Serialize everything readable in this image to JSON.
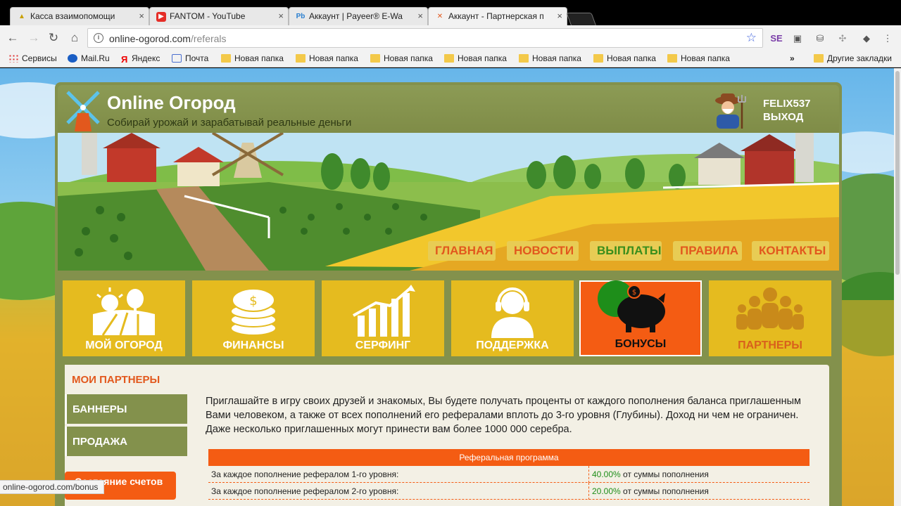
{
  "browser": {
    "tabs": [
      {
        "title": "Касса взаимопомощи",
        "icon": "warning-icon"
      },
      {
        "title": "FANTOM - YouTube",
        "icon": "youtube-icon"
      },
      {
        "title": "Аккаунт | Payeer® E-Wa",
        "icon": "payeer-icon"
      },
      {
        "title": "Аккаунт - Партнерская п",
        "icon": "windmill-icon"
      }
    ],
    "url_domain": "online-ogorod.com",
    "url_path": "/referals",
    "bookmarks": [
      "Сервисы",
      "Mail.Ru",
      "Яндекс",
      "Почта",
      "Новая папка",
      "Новая папка",
      "Новая папка",
      "Новая папка",
      "Новая папка",
      "Новая папка",
      "Новая папка"
    ],
    "overflow_label": "»",
    "other_bookmarks": "Другие закладки",
    "status_url": "online-ogorod.com/bonus"
  },
  "site": {
    "title": "Online Огород",
    "slogan": "Собирай урожай и зарабатывай реальные деньги",
    "username": "FELIX537",
    "logout": "ВЫХОД"
  },
  "nav": [
    "ГЛАВНАЯ",
    "НОВОСТИ",
    "ВЫПЛАТЫ",
    "ПРАВИЛА",
    "КОНТАКТЫ"
  ],
  "tiles": [
    {
      "label": "МОЙ ОГОРОД",
      "icon": "farm-icon"
    },
    {
      "label": "ФИНАНСЫ",
      "icon": "coins-icon"
    },
    {
      "label": "СЕРФИНГ",
      "icon": "chart-icon"
    },
    {
      "label": "ПОДДЕРЖКА",
      "icon": "support-icon"
    },
    {
      "label": "БОНУСЫ",
      "icon": "piggy-bank-icon"
    },
    {
      "label": "ПАРТНЕРЫ",
      "icon": "partners-icon"
    }
  ],
  "sidebar": {
    "active": "МОИ ПАРТНЕРЫ",
    "items": [
      "БАННЕРЫ",
      "ПРОДАЖА"
    ],
    "orange": "Состояние счетов"
  },
  "intro": "Приглашайте в игру своих друзей и знакомых, Вы будете получать проценты от каждого пополнения баланса приглашенным Вами человеком, а также от всех пополнений его рефералами вплоть до 3-го уровня (Глубины). Доход ни чем не ограничен. Даже несколько приглашенных могут принести вам более 1000 000 серебра.",
  "ref_table": {
    "title": "Реферальная программа",
    "rows": [
      {
        "label": "За каждое пополнение рефералом 1-го уровня:",
        "pct": "40.00%",
        "suffix": " от суммы пополнения"
      },
      {
        "label": "За каждое пополнение рефералом 2-го уровня:",
        "pct": "20.00%",
        "suffix": " от суммы пополнения"
      }
    ]
  },
  "colors": {
    "accent": "#f45c13",
    "tile": "#e5bb1f",
    "frame": "#83914c",
    "nav_text": "#e2581d",
    "green": "#1e8e1a"
  }
}
